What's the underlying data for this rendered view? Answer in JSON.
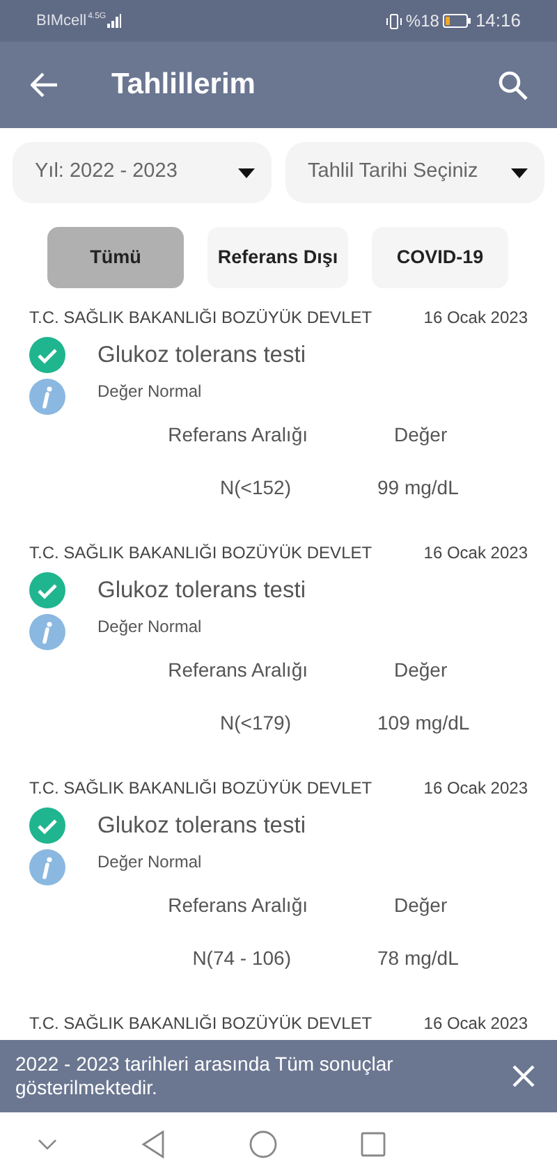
{
  "status_bar": {
    "carrier": "BIMcell",
    "network": "4.5G",
    "battery": "%18",
    "time": "14:16"
  },
  "app_bar": {
    "title": "Tahlillerim"
  },
  "filters": [
    {
      "value": "Yıl: 2022 - 2023"
    },
    {
      "value": "Tahlil Tarihi Seçiniz"
    }
  ],
  "tabs": [
    {
      "label": "Tümü",
      "selected": true
    },
    {
      "label": "Referans Dışı",
      "selected": false
    },
    {
      "label": "COVID-19",
      "selected": false
    }
  ],
  "results": [
    {
      "institution": "T.C. SAĞLIK BAKANLIĞI BOZÜYÜK DEVLET",
      "date": "16 Ocak 2023",
      "test": "Glukoz tolerans testi",
      "status": "Değer Normal",
      "normal": true,
      "range_label": "Referans Aralığı",
      "value_label": "Değer",
      "range": "N(<152)",
      "value": "99 mg/dL"
    },
    {
      "institution": "T.C. SAĞLIK BAKANLIĞI BOZÜYÜK DEVLET",
      "date": "16 Ocak 2023",
      "test": "Glukoz tolerans testi",
      "status": "Değer Normal",
      "normal": true,
      "range_label": "Referans Aralığı",
      "value_label": "Değer",
      "range": "N(<179)",
      "value": "109 mg/dL"
    },
    {
      "institution": "T.C. SAĞLIK BAKANLIĞI BOZÜYÜK DEVLET",
      "date": "16 Ocak 2023",
      "test": "Glukoz tolerans testi",
      "status": "Değer Normal",
      "normal": true,
      "range_label": "Referans Aralığı",
      "value_label": "Değer",
      "range": "N(74 - 106)",
      "value": "78 mg/dL"
    },
    {
      "institution": "T.C. SAĞLIK BAKANLIĞI BOZÜYÜK DEVLET",
      "date": "16 Ocak 2023"
    }
  ],
  "snackbar": {
    "message": "2022 - 2023 tarihleri arasında Tüm sonuçlar gösterilmektedir."
  }
}
